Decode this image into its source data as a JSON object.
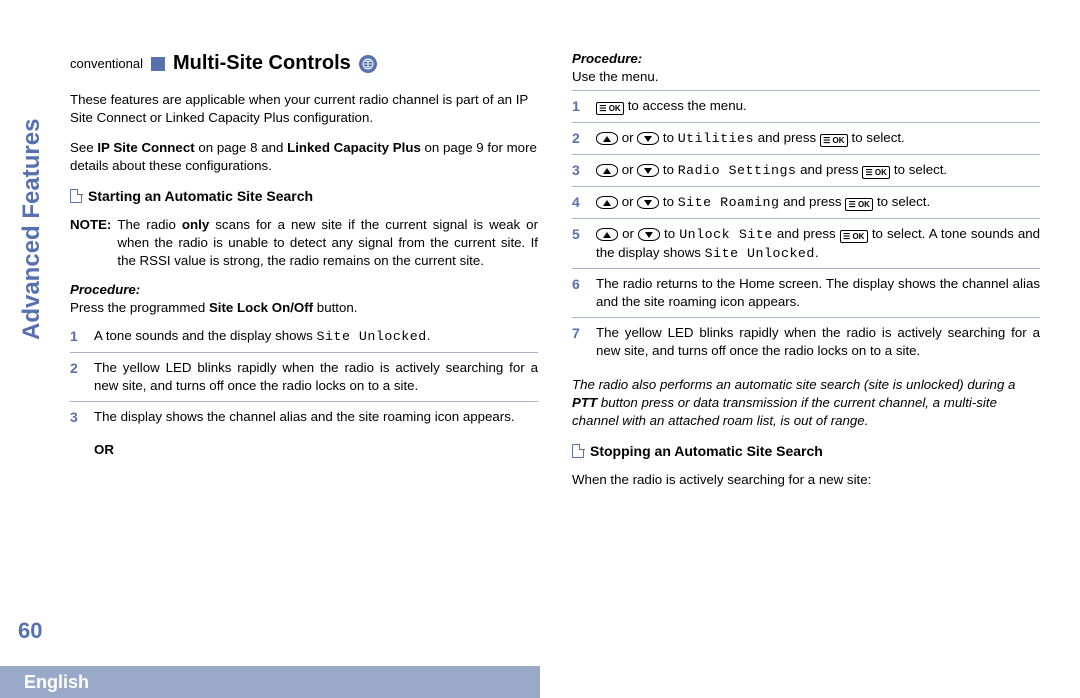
{
  "sidebar": {
    "section": "Advanced Features"
  },
  "page_number": "60",
  "footer": {
    "language": "English"
  },
  "heading": {
    "prefix": "conventional",
    "title": "Multi-Site Controls",
    "icon": "globe-icon"
  },
  "intro": {
    "p1": "These features are applicable when your current radio channel is part of an IP Site Connect or Linked Capacity Plus configuration.",
    "p2_a": "See ",
    "p2_b1": "IP Site Connect",
    "p2_c": " on page 8 and ",
    "p2_b2": "Linked Capacity Plus",
    "p2_d": " on page 9 for more details about these configurations."
  },
  "section1": {
    "title": "Starting an Automatic Site Search",
    "note_label": "NOTE:",
    "note_a": "The radio ",
    "note_b": "only",
    "note_c": " scans for a new site if the current signal is weak or when the radio is unable to detect any signal from the current site. If the RSSI value is strong, the radio remains on the current site.",
    "procedure_label": "Procedure:",
    "procedure_intro_a": "Press the programmed ",
    "procedure_intro_b": "Site Lock On/Off",
    "procedure_intro_c": " button.",
    "steps": [
      {
        "n": "1",
        "t_a": "A tone sounds and the display shows ",
        "t_mono": "Site Unlocked",
        "t_b": "."
      },
      {
        "n": "2",
        "t": "The yellow LED blinks rapidly when the radio is actively searching for a new site, and turns off once the radio locks on to a site."
      },
      {
        "n": "3",
        "t": "The display shows the channel alias and the site roaming icon appears."
      }
    ],
    "or_label": "OR"
  },
  "col2": {
    "procedure_label": "Procedure:",
    "procedure_intro": "Use the menu.",
    "steps": [
      {
        "n": "1",
        "pre": "",
        "ok": true,
        "post": " to access the menu."
      },
      {
        "n": "2",
        "arrows": true,
        "mid": " to ",
        "mono": "Utilities",
        "post_a": " and press ",
        "ok2": true,
        "post_b": " to select."
      },
      {
        "n": "3",
        "arrows": true,
        "mid": " to ",
        "mono": "Radio Settings",
        "post_a": " and press ",
        "ok2": true,
        "post_b": " to select."
      },
      {
        "n": "4",
        "arrows": true,
        "mid": " to ",
        "mono": "Site Roaming",
        "post_a": " and press ",
        "ok2": true,
        "post_b": " to select."
      },
      {
        "n": "5",
        "arrows": true,
        "mid": " to ",
        "mono": "Unlock Site",
        "post_a": " and press ",
        "ok2": true,
        "post_b": " to select. A tone sounds and the display shows ",
        "mono2": "Site Unlocked",
        "post_c": "."
      },
      {
        "n": "6",
        "plain": "The radio returns to the Home screen. The display shows the channel alias and the site roaming icon appears."
      },
      {
        "n": "7",
        "plain": "The yellow LED blinks rapidly when the radio is actively searching for a new site, and turns off once the radio locks on to a site."
      }
    ],
    "italic_a": "The radio also performs an automatic site search (site is unlocked) during a ",
    "italic_b": "PTT",
    "italic_c": " button press or data transmission if the current channel, a multi-site channel with an attached roam list, is out of range."
  },
  "section2": {
    "title": "Stopping an Automatic Site Search",
    "intro": "When the radio is actively searching for a new site:"
  },
  "keys": {
    "ok_label": "☰ OK"
  }
}
